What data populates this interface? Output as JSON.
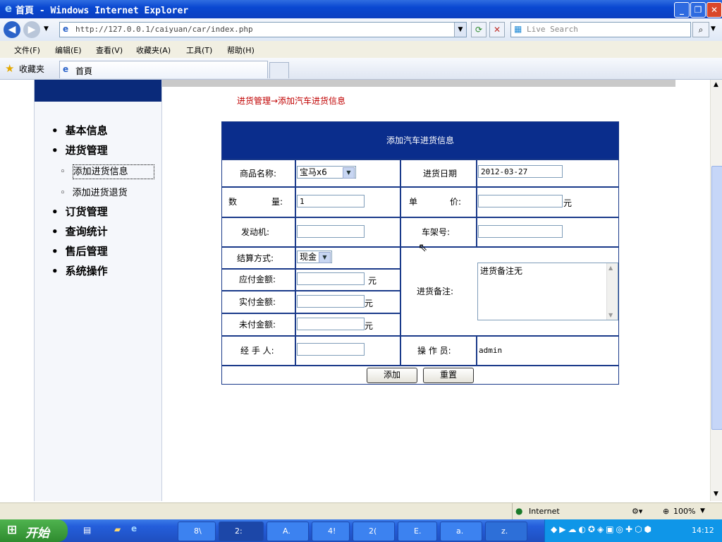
{
  "window": {
    "title": "首頁 - Windows Internet Explorer"
  },
  "address": {
    "url": "http://127.0.0.1/caiyuan/car/index.php",
    "search_placeholder": "Live Search"
  },
  "menubar": {
    "items": [
      "文件(F)",
      "编辑(E)",
      "查看(V)",
      "收藏夹(A)",
      "工具(T)",
      "帮助(H)"
    ]
  },
  "favorites": {
    "label": "收藏夹"
  },
  "tabs": [
    {
      "label": "首頁"
    }
  ],
  "sidebar": {
    "items": [
      {
        "label": "基本信息"
      },
      {
        "label": "进货管理"
      },
      {
        "label": "添加进货信息"
      },
      {
        "label": "添加进货退货"
      },
      {
        "label": "订货管理"
      },
      {
        "label": "查询统计"
      },
      {
        "label": "售后管理"
      },
      {
        "label": "系统操作"
      }
    ]
  },
  "breadcrumb": "进货管理→添加汽车进货信息",
  "form": {
    "header": "添加汽车进货信息",
    "product_label": "商品名称:",
    "product_value": "宝马x6",
    "date_label": "进货日期",
    "date_value": "2012-03-27",
    "qty_label_a": "数",
    "qty_label_b": "量:",
    "qty_value": "1",
    "price_label_a": "单",
    "price_label_b": "价:",
    "price_unit": "元",
    "engine_label": "发动机:",
    "frame_label": "车架号:",
    "pay_label": "结算方式:",
    "pay_value": "现金",
    "payable_label": "应付金额:",
    "payable_unit": "元",
    "paid_label": "实付金额:",
    "paid_unit": "元",
    "unpaid_label": "未付金额:",
    "unpaid_unit": "元",
    "remark_label": "进货备注:",
    "remark_value": "进货备注无",
    "handler_label": "经 手 人:",
    "operator_label": "操 作 员:",
    "operator_value": "admin",
    "add_button": "添加",
    "reset_button": "重置"
  },
  "status": {
    "zone": "Internet",
    "zoom": "100%"
  },
  "taskbar": {
    "start": "开始",
    "tasks": [
      "8\\",
      "2:",
      "A.",
      "4!",
      "2(",
      "E.",
      "a.",
      "z."
    ],
    "clock": "14:12"
  }
}
